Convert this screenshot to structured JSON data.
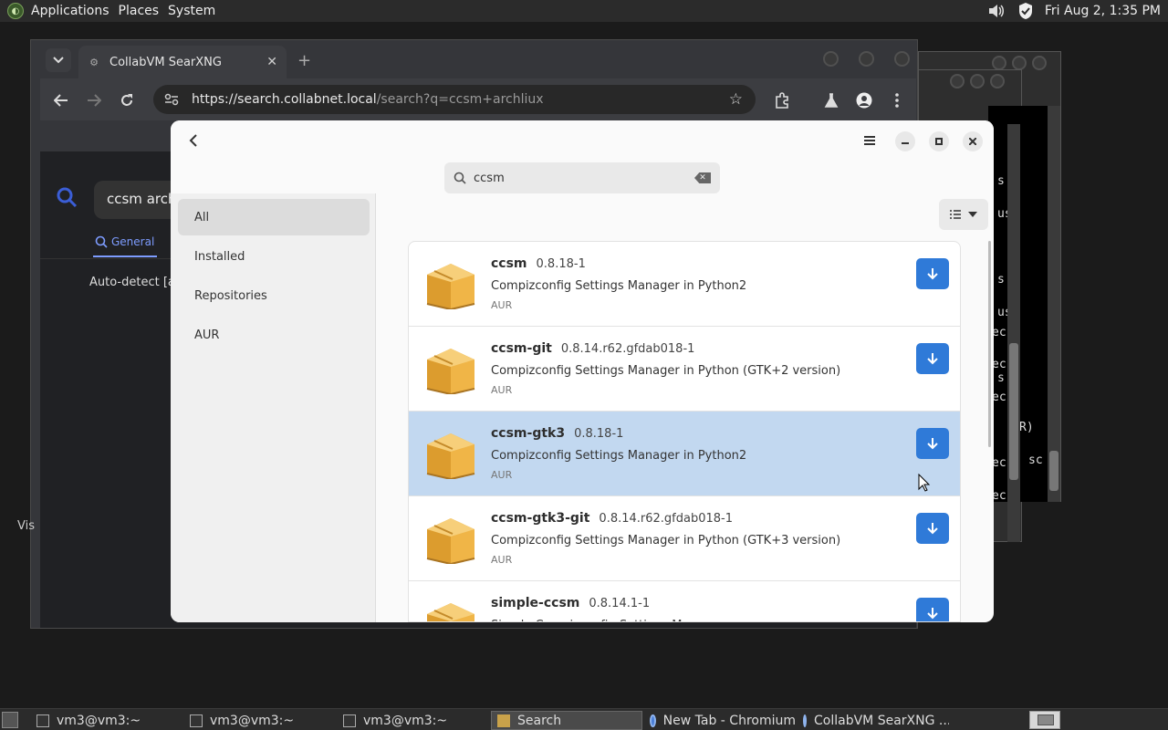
{
  "top_panel": {
    "menus": [
      "Applications",
      "Places",
      "System"
    ],
    "clock": "Fri Aug  2,  1:35 PM"
  },
  "terminal": {
    "lines": [
      "s a",
      "usi",
      "s a",
      "usi",
      "ec",
      "s a",
      "ec",
      "ec",
      "R)",
      "ec",
      "sc",
      "ec"
    ]
  },
  "browser": {
    "tab_title": "CollabVM SearXNG",
    "url_host": "https://search.collabnet.local",
    "url_path": "/search?q=ccsm+archliux",
    "searxng": {
      "query": "ccsm arch",
      "tab_general": "General",
      "language": "Auto-detect [au"
    },
    "behind_text": "Vis"
  },
  "pamac": {
    "search_value": "ccsm",
    "sidebar": [
      "All",
      "Installed",
      "Repositories",
      "AUR"
    ],
    "selected_sidebar": "All",
    "packages": [
      {
        "name": "ccsm",
        "version": "0.8.18-1",
        "desc": "Compizconfig Settings Manager in Python2",
        "repo": "AUR",
        "selected": false
      },
      {
        "name": "ccsm-git",
        "version": "0.8.14.r62.gfdab018-1",
        "desc": "Compizconfig Settings Manager in Python (GTK+2 version)",
        "repo": "AUR",
        "selected": false
      },
      {
        "name": "ccsm-gtk3",
        "version": "0.8.18-1",
        "desc": "Compizconfig Settings Manager in Python2",
        "repo": "AUR",
        "selected": true
      },
      {
        "name": "ccsm-gtk3-git",
        "version": "0.8.14.r62.gfdab018-1",
        "desc": "Compizconfig Settings Manager in Python (GTK+3 version)",
        "repo": "AUR",
        "selected": false
      },
      {
        "name": "simple-ccsm",
        "version": "0.8.14.1-1",
        "desc": "Simple Compizconfig Settings Manager",
        "repo": "AUR",
        "selected": false
      }
    ]
  },
  "taskbar": {
    "items": [
      {
        "label": "vm3@vm3:~",
        "icon": "terminal-icon",
        "active": false
      },
      {
        "label": "vm3@vm3:~",
        "icon": "terminal-icon",
        "active": false
      },
      {
        "label": "vm3@vm3:~",
        "icon": "terminal-icon",
        "active": false
      },
      {
        "label": "Search",
        "icon": "search-app-icon",
        "active": true
      },
      {
        "label": "New Tab - Chromium",
        "icon": "chromium-icon",
        "active": false
      },
      {
        "label": "CollabVM SearXNG ...",
        "icon": "chromium-icon",
        "active": false
      }
    ]
  },
  "colors": {
    "accent": "#2f7ad8",
    "selection": "#c2d8f0"
  }
}
